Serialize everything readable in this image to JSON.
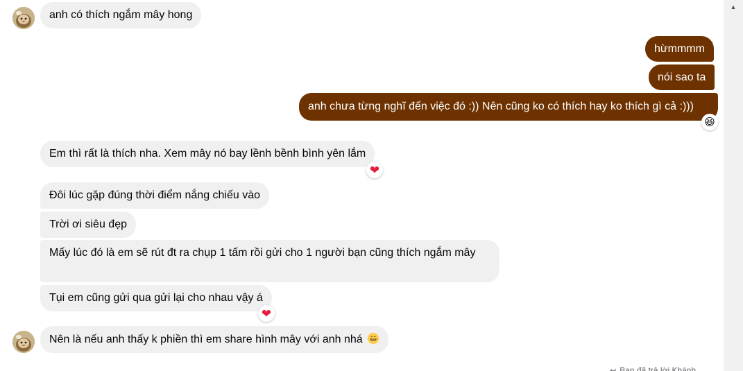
{
  "conversation": {
    "messages": [
      {
        "direction": "incoming",
        "text": "anh có thích ngắm mây hong"
      },
      {
        "direction": "outgoing",
        "text": "hừmmmm"
      },
      {
        "direction": "outgoing",
        "text": "nói sao ta"
      },
      {
        "direction": "outgoing",
        "text": "anh chưa từng nghĩ đến việc đó :)) Nên cũng ko có thích hay ko thích gì cả :)))",
        "reaction": "😆"
      },
      {
        "direction": "incoming",
        "text": "Em thì rất là thích nha. Xem mây nó bay lềnh bềnh bình yên lắm",
        "reaction": "❤"
      },
      {
        "direction": "incoming",
        "text": "Đôi lúc gặp đúng thời điểm nắng chiếu vào"
      },
      {
        "direction": "incoming",
        "text": "Trời ơi siêu đẹp"
      },
      {
        "direction": "incoming",
        "text": "Mấy lúc đó là em sẽ rút đt ra chụp 1 tấm rồi gửi cho 1 người bạn cũng thích ngắm mây"
      },
      {
        "direction": "incoming",
        "text": "Tụi em cũng gửi qua gửi lại cho nhau vậy á",
        "reaction": "❤"
      },
      {
        "direction": "incoming",
        "text": "Nên là nếu anh thấy k phiền thì em  share hình mây với anh nhá",
        "inline_emoji": "grinning-face"
      }
    ]
  },
  "reply_note": {
    "text": "Bạn đã trả lời Khánh"
  },
  "colors": {
    "incoming_bubble": "#f0f0f0",
    "outgoing_bubble": "#6e3200",
    "heart": "#e41e3f"
  }
}
